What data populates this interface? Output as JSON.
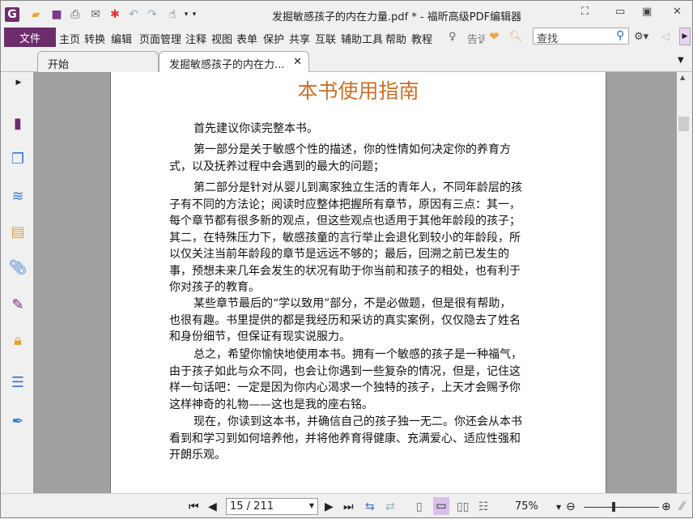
{
  "window": {
    "title": "发掘敏感孩子的内在力量.pdf * - 福昕高级PDF编辑器"
  },
  "menu": {
    "file": "文件",
    "items": [
      "主页",
      "转换",
      "编辑",
      "页面管理",
      "注释",
      "视图",
      "表单",
      "保护",
      "共享",
      "互联",
      "辅助工具",
      "帮助",
      "教程"
    ],
    "tell_me": "告诉",
    "search_placeholder": "查找"
  },
  "tabs": [
    {
      "label": "开始"
    },
    {
      "label": "发掘敏感孩子的内在力..."
    }
  ],
  "document": {
    "title": "本书使用指南",
    "paragraphs": [
      [
        "首先建议你读完整本书。"
      ],
      [
        "第一部分是关于敏感个性的描述，你的性情如何决定你的养育方",
        "式，以及抚养过程中会遇到的最大的问题；"
      ],
      [
        "第二部分是针对从婴儿到离家独立生活的青年人，不同年龄层的孩",
        "子有不同的方法论；阅读时应整体把握所有章节，原因有三点：其一，",
        "每个章节都有很多新的观点，但这些观点也适用于其他年龄段的孩子；",
        "其二，在特殊压力下，敏感孩童的言行举止会退化到较小的年龄段，所",
        "以仅关注当前年龄段的章节是远远不够的；最后，回溯之前已发生的",
        "事，预想未来几年会发生的状况有助于你当前和孩子的相处，也有利于",
        "你对孩子的教育。"
      ],
      [
        "某些章节最后的“学以致用”部分，不是必做题，但是很有帮助，",
        "也很有趣。书里提供的都是我经历和采访的真实案例，仅仅隐去了姓名",
        "和身份细节，但保证有现实说服力。"
      ],
      [
        "总之，希望你愉快地使用本书。拥有一个敏感的孩子是一种福气，",
        "由于孩子如此与众不同，也会让你遇到一些复杂的情况，但是，记住这",
        "样一句话吧：一定是因为你内心渴求一个独特的孩子，上天才会赐予你",
        "这样神奇的礼物——这也是我的座右铭。"
      ],
      [
        "现在，你读到这本书，并确信自己的孩子独一无二。你还会从本书",
        "看到和学习到如何培养他，并将他养育得健康、充满爱心、适应性强和",
        "开朗乐观。"
      ]
    ]
  },
  "status": {
    "page": "15 / 211",
    "zoom": "75%",
    "zoom_fraction": 0.4
  },
  "colors": {
    "brand": "#6d2d6c",
    "title": "#c8702a"
  }
}
